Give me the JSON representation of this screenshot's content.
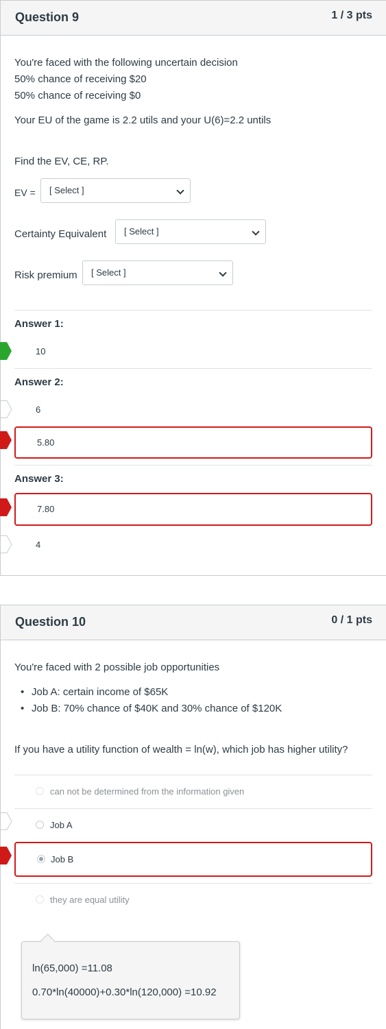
{
  "colors": {
    "correct": "#2aa62f",
    "wrong": "#d01a19",
    "border": "#c7cdd1"
  },
  "q9": {
    "title": "Question 9",
    "points": "1 / 3 pts",
    "intro": [
      "You're faced with the following uncertain decision",
      "50% chance of receiving $20",
      "50% chance of receiving $0"
    ],
    "eu_line": "Your EU of the game is 2.2 utils and your U(6)=2.2 untils",
    "find": "Find the EV, CE, RP.",
    "ev_label": "EV =",
    "ce_label": "Certainty Equivalent",
    "rp_label": "Risk premium",
    "select_placeholder": "[ Select ]",
    "answers": [
      {
        "label": "Answer 1:",
        "options": [
          {
            "value": "10",
            "marker": "correct"
          }
        ]
      },
      {
        "label": "Answer 2:",
        "options": [
          {
            "value": "6",
            "marker": "missed"
          },
          {
            "value": "5.80",
            "marker": "wrong"
          }
        ]
      },
      {
        "label": "Answer 3:",
        "options": [
          {
            "value": "7.80",
            "marker": "wrong"
          },
          {
            "value": "4",
            "marker": "missed"
          }
        ]
      }
    ]
  },
  "q10": {
    "title": "Question 10",
    "points": "0 / 1 pts",
    "intro": "You're faced with 2 possible job opportunities",
    "bullets": [
      "Job A: certain income of $65K",
      "Job B: 70% chance of $40K and 30% chance of $120K"
    ],
    "question": "If you have a utility function of wealth = ln(w), which job has higher utility?",
    "options": [
      {
        "label": "can not be determined from the information given",
        "state": "faded"
      },
      {
        "label": "Job A",
        "state": "missed"
      },
      {
        "label": "Job B",
        "state": "wrong-selected"
      },
      {
        "label": "they are equal utility",
        "state": "faded"
      }
    ],
    "feedback": [
      "ln(65,000) =11.08",
      "0.70*ln(40000)+0.30*ln(120,000) =10.92"
    ]
  }
}
